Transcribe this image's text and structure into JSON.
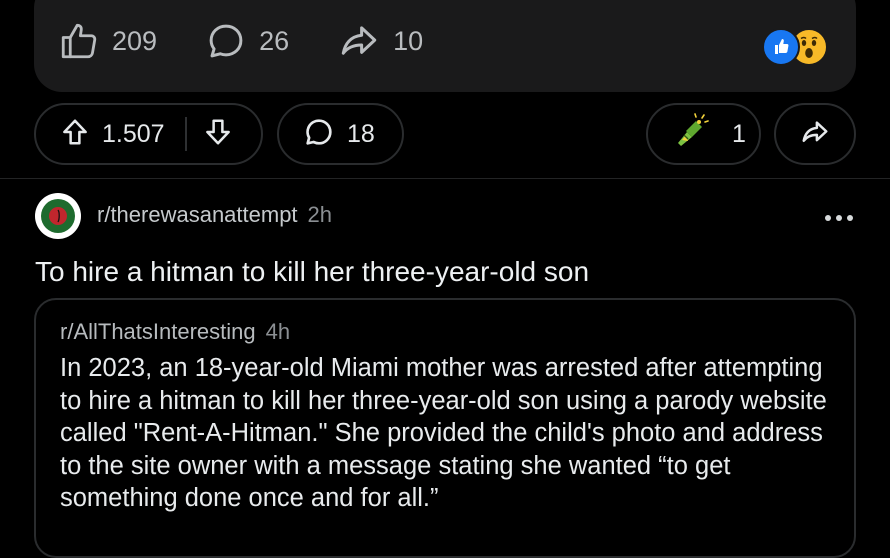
{
  "facebook_bar": {
    "likes": "209",
    "comments": "26",
    "shares": "10",
    "reactions": [
      "like",
      "wow"
    ]
  },
  "actions": {
    "score": "1.507",
    "comments": "18",
    "awards": "1"
  },
  "post": {
    "subreddit": "r/therewasanattempt",
    "time": "2h",
    "title": "To hire a hitman to kill her three-year-old son"
  },
  "crosspost": {
    "subreddit": "r/AllThatsInteresting",
    "time": "4h",
    "body": "In 2023, an 18-year-old Miami mother was arrested after attempting to hire a hitman to kill her three-year-old son using a parody website called \"Rent-A-Hitman.\" She provided the child's photo and address to the site owner with a message stating she wanted “to get something done once and for all.”"
  },
  "colors": {
    "background": "#000000",
    "card": "#1a1a1b",
    "border": "#2a2c2e",
    "text": "#e6e9eb",
    "muted": "#8b8f93",
    "like_blue": "#1877f2",
    "wow_yellow": "#f7b928"
  },
  "icons": [
    "thumbs-up-icon",
    "comment-bubble-icon",
    "share-arrow-icon",
    "upvote-icon",
    "downvote-icon",
    "chat-icon",
    "award-icon",
    "share-icon",
    "more-dots-icon"
  ]
}
